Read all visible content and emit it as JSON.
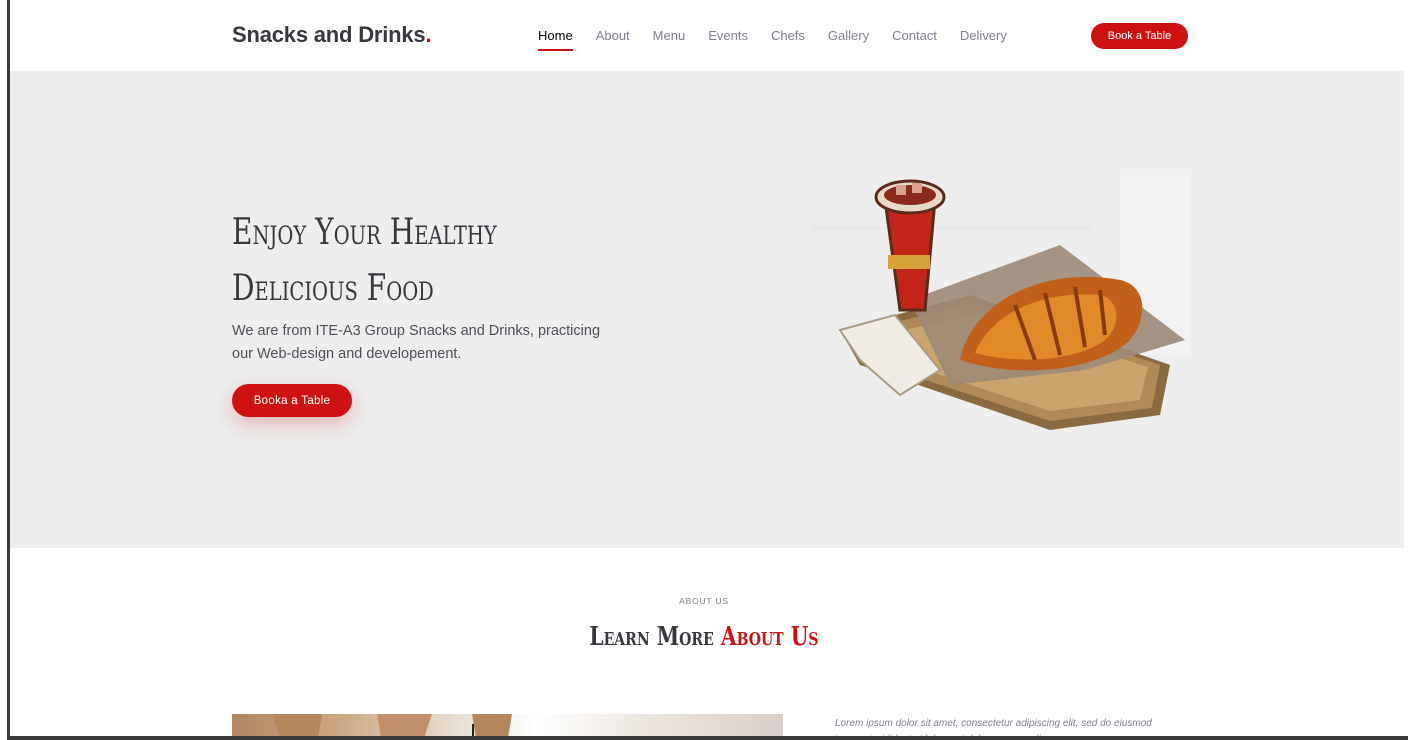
{
  "header": {
    "logo_text": "Snacks and Drinks",
    "logo_dot": ".",
    "nav": [
      {
        "label": "Home",
        "active": true
      },
      {
        "label": "About"
      },
      {
        "label": "Menu"
      },
      {
        "label": "Events"
      },
      {
        "label": "Chefs"
      },
      {
        "label": "Gallery"
      },
      {
        "label": "Contact"
      },
      {
        "label": "Delivery"
      }
    ],
    "book_button": "Book a Table"
  },
  "hero": {
    "title_line1": "Enjoy Your Healthy",
    "title_line2": "Delicious Food",
    "description": "We are from ITE-A3 Group Snacks and Drinks, practicing our Web-design and developement.",
    "button": "Booka a Table"
  },
  "about": {
    "subtitle": "ABOUT US",
    "title_main": "Learn More ",
    "title_accent": "About Us",
    "text": "Lorem ipsum dolor sit amet, consectetur adipiscing elit, sed do eiusmod tempor incididunt ut labore et dolore magna aliqua."
  },
  "colors": {
    "accent": "#ce1212",
    "hero_bg": "#eeeeee",
    "heading": "#37373f"
  }
}
